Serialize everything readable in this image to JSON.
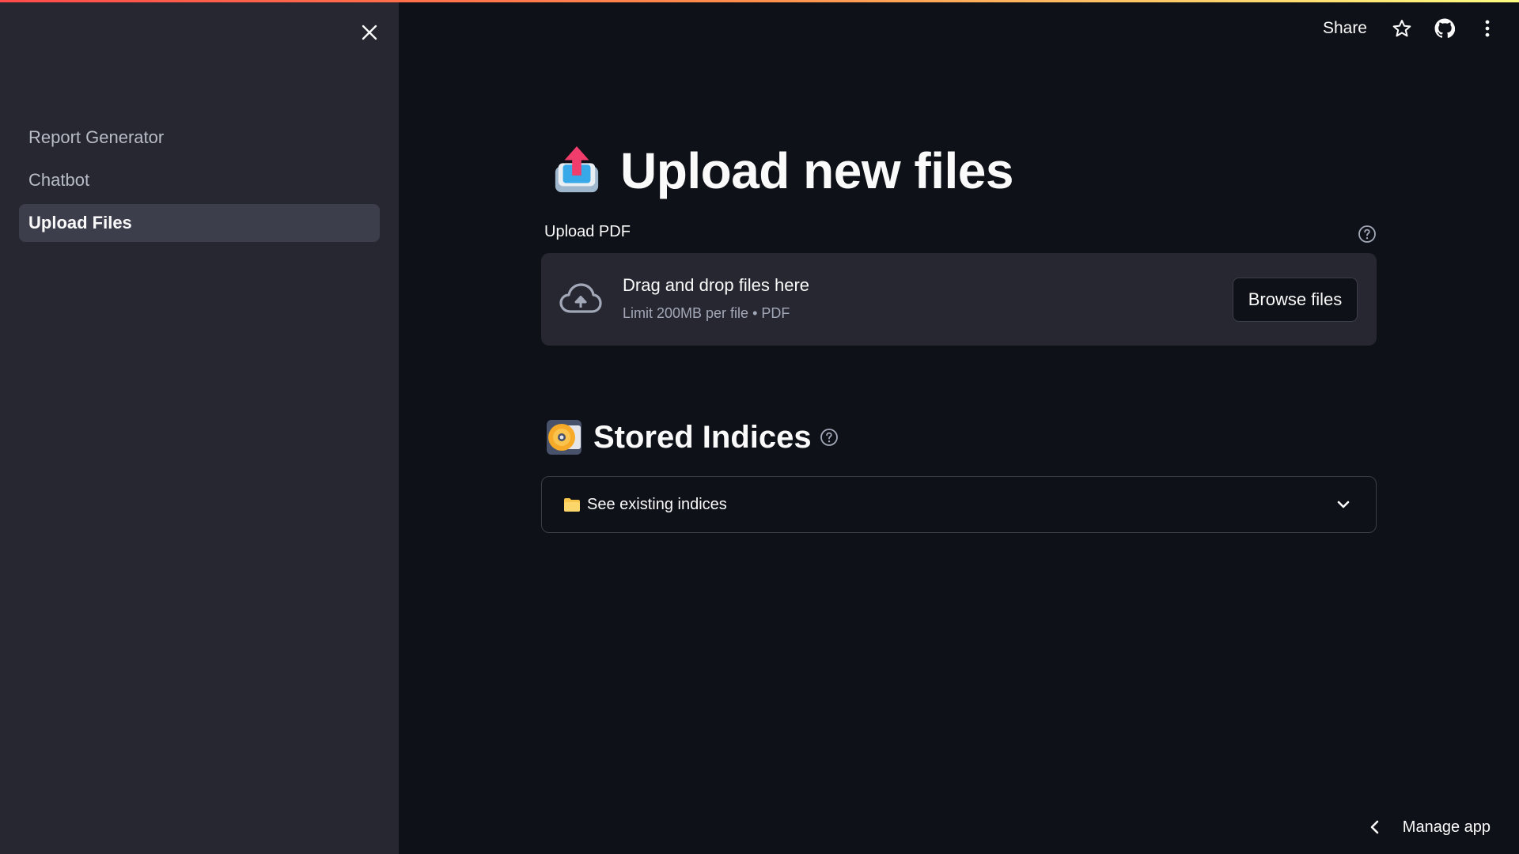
{
  "sidebar": {
    "items": [
      {
        "label": "Report Generator",
        "active": false
      },
      {
        "label": "Chatbot",
        "active": false
      },
      {
        "label": "Upload Files",
        "active": true
      }
    ]
  },
  "header": {
    "share_label": "Share",
    "icons": [
      "star-icon",
      "github-icon",
      "more-vertical-icon"
    ]
  },
  "main": {
    "title": "Upload new files",
    "title_emoji": "outbox-tray-emoji",
    "uploader": {
      "label": "Upload PDF",
      "drop_text": "Drag and drop files here",
      "limit_text": "Limit 200MB per file • PDF",
      "browse_label": "Browse files"
    },
    "stored": {
      "title": "Stored Indices",
      "title_emoji": "dvd-emoji",
      "expander_label": "See existing indices",
      "expander_icon": "folder-emoji"
    }
  },
  "footer": {
    "manage_label": "Manage app"
  },
  "colors": {
    "background": "#0e1117",
    "sidebar": "#262730",
    "active_item": "#3d3e4b",
    "accent_top_bar": "#ff4b4b"
  }
}
